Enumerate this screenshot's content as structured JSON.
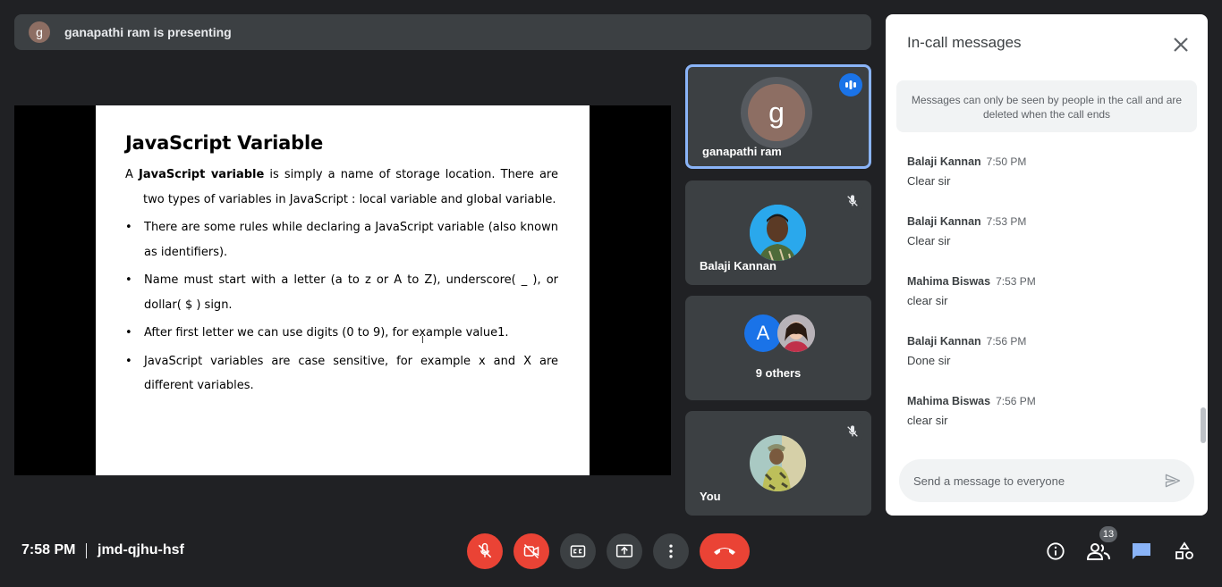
{
  "presenting": {
    "avatar_letter": "g",
    "text": "ganapathi ram is presenting"
  },
  "slide": {
    "title": "JavaScript Variable",
    "intro_a": "A ",
    "intro_bold": "JavaScript variable",
    "intro_rest": " is simply a name of storage location. There are two types of variables in JavaScript : local variable and global variable.",
    "bullets": [
      "There are some rules while declaring a JavaScript variable (also known as identifiers).",
      "Name must start with a letter (a to z or A to Z), underscore( _ ), or dollar( $ ) sign.",
      "After first letter we can use digits (0 to 9), for example value1.",
      "JavaScript variables are case sensitive, for example x and X are different variables."
    ]
  },
  "tiles": {
    "presenter": {
      "name": "ganapathi ram",
      "avatar_letter": "g"
    },
    "balaji": {
      "name": "Balaji Kannan"
    },
    "others": {
      "avatar_letter": "A",
      "label": "9 others"
    },
    "you": {
      "name": "You"
    }
  },
  "chat": {
    "title": "In-call messages",
    "notice": "Messages can only be seen by people in the call and are deleted when the call ends",
    "messages": [
      {
        "sender": "Balaji Kannan",
        "time": "7:50 PM",
        "text": "Clear sir"
      },
      {
        "sender": "Balaji Kannan",
        "time": "7:53 PM",
        "text": "Clear sir"
      },
      {
        "sender": "Mahima Biswas",
        "time": "7:53 PM",
        "text": "clear sir"
      },
      {
        "sender": "Balaji Kannan",
        "time": "7:56 PM",
        "text": "Done sir"
      },
      {
        "sender": "Mahima Biswas",
        "time": "7:56 PM",
        "text": "clear sir"
      }
    ],
    "input_placeholder": "Send a message to everyone"
  },
  "bottom": {
    "time": "7:58 PM",
    "meeting_code": "jmd-qjhu-hsf",
    "participants_count": "13"
  },
  "icons": {
    "mic": "mic-off-icon",
    "camera": "camera-off-icon",
    "captions": "closed-captions-icon",
    "present": "present-screen-icon",
    "more": "more-vert-icon",
    "end": "end-call-icon",
    "info": "info-icon",
    "people": "people-icon",
    "chat": "chat-icon",
    "activities": "activities-icon"
  },
  "colors": {
    "end_call": "#ea4335",
    "accent": "#8ab4f8",
    "speaking": "#1a73e8",
    "chat_icon": "#8ab4f8"
  }
}
